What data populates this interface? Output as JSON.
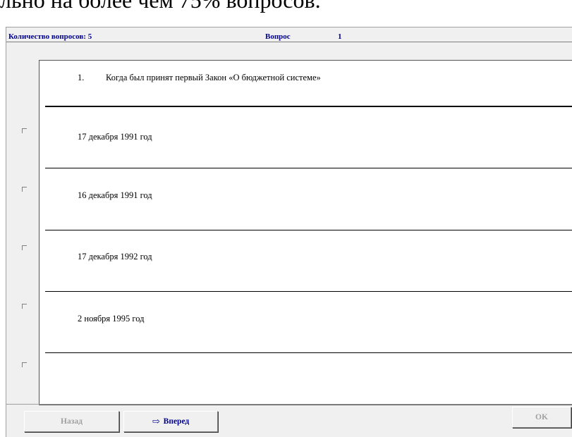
{
  "caption": "льно на более чем 75% вопросов.",
  "header": {
    "count_label": "Количество вопросов: 5",
    "question_label": "Вопрос",
    "question_number": "1"
  },
  "question": {
    "number": "1.",
    "text": "Когда был принят первый Закон «О бюджетной системе»"
  },
  "answers": [
    {
      "label": "17 декабря 1991 год",
      "checked": false
    },
    {
      "label": "16 декабря 1991 год",
      "checked": false
    },
    {
      "label": "17 декабря 1992 год",
      "checked": false
    },
    {
      "label": "2  ноября 1995 год",
      "checked": false
    },
    {
      "label": "",
      "checked": false
    }
  ],
  "buttons": {
    "back": "Назад",
    "next": "Вперед",
    "next_icon": "arrow-right-icon",
    "ok": "OK"
  }
}
